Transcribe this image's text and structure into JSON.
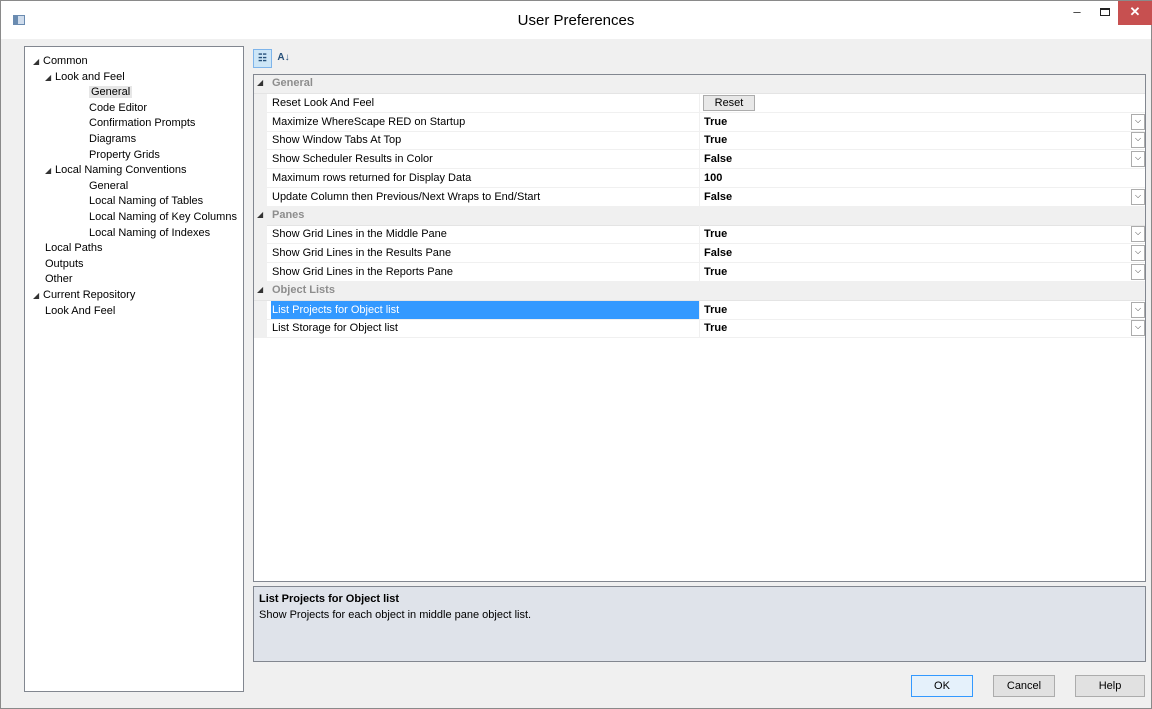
{
  "window": {
    "title": "User Preferences",
    "minimize": "–",
    "close": "✕"
  },
  "tree": {
    "items": [
      {
        "label": "Common",
        "level": 0,
        "expanded": true
      },
      {
        "label": "Look and Feel",
        "level": 1,
        "expanded": true
      },
      {
        "label": "General",
        "level": 2,
        "selected": true
      },
      {
        "label": "Code Editor",
        "level": 2
      },
      {
        "label": "Confirmation Prompts",
        "level": 2
      },
      {
        "label": "Diagrams",
        "level": 2
      },
      {
        "label": "Property Grids",
        "level": 2
      },
      {
        "label": "Local Naming Conventions",
        "level": 1,
        "expanded": true
      },
      {
        "label": "General",
        "level": 2
      },
      {
        "label": "Local Naming of Tables",
        "level": 2
      },
      {
        "label": "Local Naming of Key Columns",
        "level": 2
      },
      {
        "label": "Local Naming of Indexes",
        "level": 2
      },
      {
        "label": "Local Paths",
        "level": 1
      },
      {
        "label": "Outputs",
        "level": 1
      },
      {
        "label": "Other",
        "level": 1
      },
      {
        "label": "Current Repository",
        "level": 0,
        "expanded": true
      },
      {
        "label": "Look And Feel",
        "level": 1
      }
    ]
  },
  "toolbar": {
    "categorized_icon": "categorized-icon",
    "alphabetical_icon": "alphabetical-sort-icon",
    "alphabetical_glyph": "A↓"
  },
  "grid": {
    "categories": [
      {
        "name": "General",
        "rows": [
          {
            "name": "Reset Look And Feel",
            "value": "Reset",
            "type": "button"
          },
          {
            "name": "Maximize WhereScape RED on Startup",
            "value": "True",
            "type": "dropdown"
          },
          {
            "name": "Show Window Tabs At Top",
            "value": "True",
            "type": "dropdown"
          },
          {
            "name": "Show Scheduler Results in Color",
            "value": "False",
            "type": "dropdown"
          },
          {
            "name": "Maximum rows returned for Display Data",
            "value": "100",
            "type": "text"
          },
          {
            "name": "Update Column then Previous/Next Wraps to End/Start",
            "value": "False",
            "type": "dropdown"
          }
        ]
      },
      {
        "name": "Panes",
        "rows": [
          {
            "name": "Show Grid Lines in the Middle Pane",
            "value": "True",
            "type": "dropdown"
          },
          {
            "name": "Show Grid Lines in the Results Pane",
            "value": "False",
            "type": "dropdown"
          },
          {
            "name": "Show Grid Lines in the Reports Pane",
            "value": "True",
            "type": "dropdown"
          }
        ]
      },
      {
        "name": "Object Lists",
        "rows": [
          {
            "name": "List Projects for Object list",
            "value": "True",
            "type": "dropdown",
            "selected": true
          },
          {
            "name": "List Storage for Object list",
            "value": "True",
            "type": "dropdown"
          }
        ]
      }
    ]
  },
  "description": {
    "title": "List Projects for Object list",
    "text": "Show Projects for each object in middle pane object list."
  },
  "buttons": {
    "ok": "OK",
    "cancel": "Cancel",
    "help": "Help"
  },
  "colors": {
    "selection": "#3399ff",
    "close_button": "#c75050",
    "description_bg": "#dfe3ea"
  }
}
